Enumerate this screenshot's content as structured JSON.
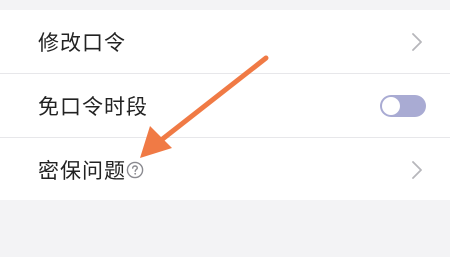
{
  "settings": {
    "items": [
      {
        "label": "修改口令",
        "control": "chevron"
      },
      {
        "label": "免口令时段",
        "control": "toggle",
        "enabled": false
      },
      {
        "label": "密保问题",
        "control": "chevron",
        "has_help": true
      }
    ]
  },
  "icons": {
    "chevron": "chevron-right-icon",
    "help": "question-circle-icon",
    "annotation": "arrow-pointer"
  },
  "colors": {
    "page_bg": "#f3f3f5",
    "row_bg": "#ffffff",
    "text": "#222222",
    "chevron": "#b7b7bb",
    "toggle_off_track": "#a9abd3",
    "annotation_arrow": "#f07a45"
  }
}
